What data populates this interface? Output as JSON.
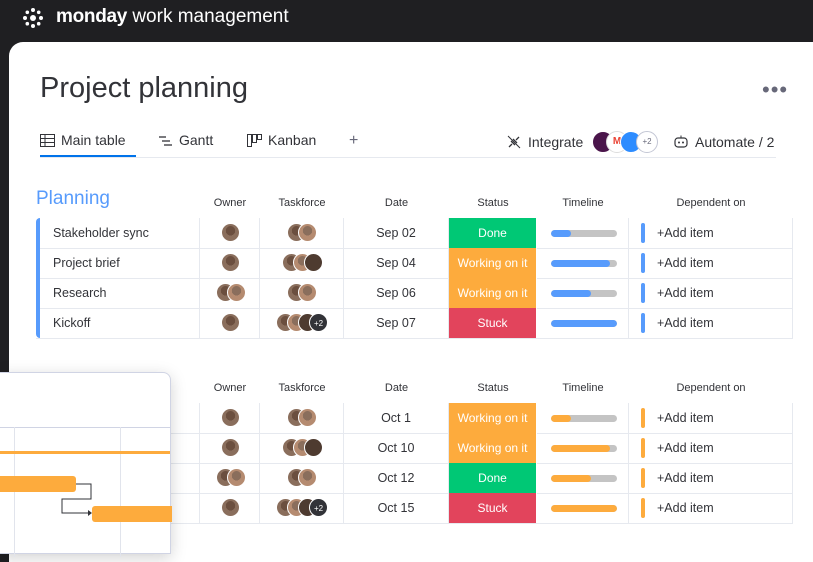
{
  "app": {
    "brand_bold": "monday",
    "brand_rest": " work management"
  },
  "page": {
    "title": "Project planning",
    "more_label": "•••"
  },
  "views": [
    {
      "label": "Main table",
      "icon": "table-icon"
    },
    {
      "label": "Gantt",
      "icon": "gantt-icon"
    },
    {
      "label": "Kanban",
      "icon": "kanban-icon"
    },
    {
      "label": "+",
      "icon": "plus-icon"
    }
  ],
  "toolbar": {
    "integrate_label": "Integrate",
    "integrations_more": "+2",
    "automate_label": "Automate / 2"
  },
  "colors": {
    "done": "#00c875",
    "working": "#fdab3d",
    "stuck": "#e2445c",
    "blue": "#579bfc",
    "orange": "#fdab3d"
  },
  "columns": [
    "Owner",
    "Taskforce",
    "Date",
    "Status",
    "Timeline",
    "Dependent on"
  ],
  "groups": [
    {
      "title": "Planning",
      "color": "#579bfc",
      "rows": [
        {
          "name": "Stakeholder sync",
          "date": "Sep 02",
          "status": "Done",
          "timeline": 0.3,
          "dependent": "+Add item",
          "owners": 1,
          "taskforce": 2,
          "taskforce_more": ""
        },
        {
          "name": "Project brief",
          "date": "Sep 04",
          "status": "Working on it",
          "timeline": 0.9,
          "dependent": "+Add item",
          "owners": 1,
          "taskforce": 3,
          "taskforce_more": ""
        },
        {
          "name": "Research",
          "date": "Sep 06",
          "status": "Working on it",
          "timeline": 0.6,
          "dependent": "+Add item",
          "owners": 2,
          "taskforce": 2,
          "taskforce_more": ""
        },
        {
          "name": "Kickoff",
          "date": "Sep 07",
          "status": "Stuck",
          "timeline": 1.0,
          "dependent": "+Add item",
          "owners": 1,
          "taskforce": 3,
          "taskforce_more": "+2"
        }
      ]
    },
    {
      "title": "",
      "color": "#fdab3d",
      "rows": [
        {
          "name": "",
          "date": "Oct 1",
          "status": "Working on it",
          "timeline": 0.3,
          "dependent": "+Add item",
          "owners": 1,
          "taskforce": 2,
          "taskforce_more": ""
        },
        {
          "name": "",
          "date": "Oct 10",
          "status": "Working on it",
          "timeline": 0.9,
          "dependent": "+Add item",
          "owners": 1,
          "taskforce": 3,
          "taskforce_more": ""
        },
        {
          "name": "",
          "date": "Oct 12",
          "status": "Done",
          "timeline": 0.6,
          "dependent": "+Add item",
          "owners": 2,
          "taskforce": 2,
          "taskforce_more": ""
        },
        {
          "name": "",
          "date": "Oct 15",
          "status": "Stuck",
          "timeline": 1.0,
          "dependent": "+Add item",
          "owners": 1,
          "taskforce": 3,
          "taskforce_more": "+2"
        }
      ]
    }
  ]
}
